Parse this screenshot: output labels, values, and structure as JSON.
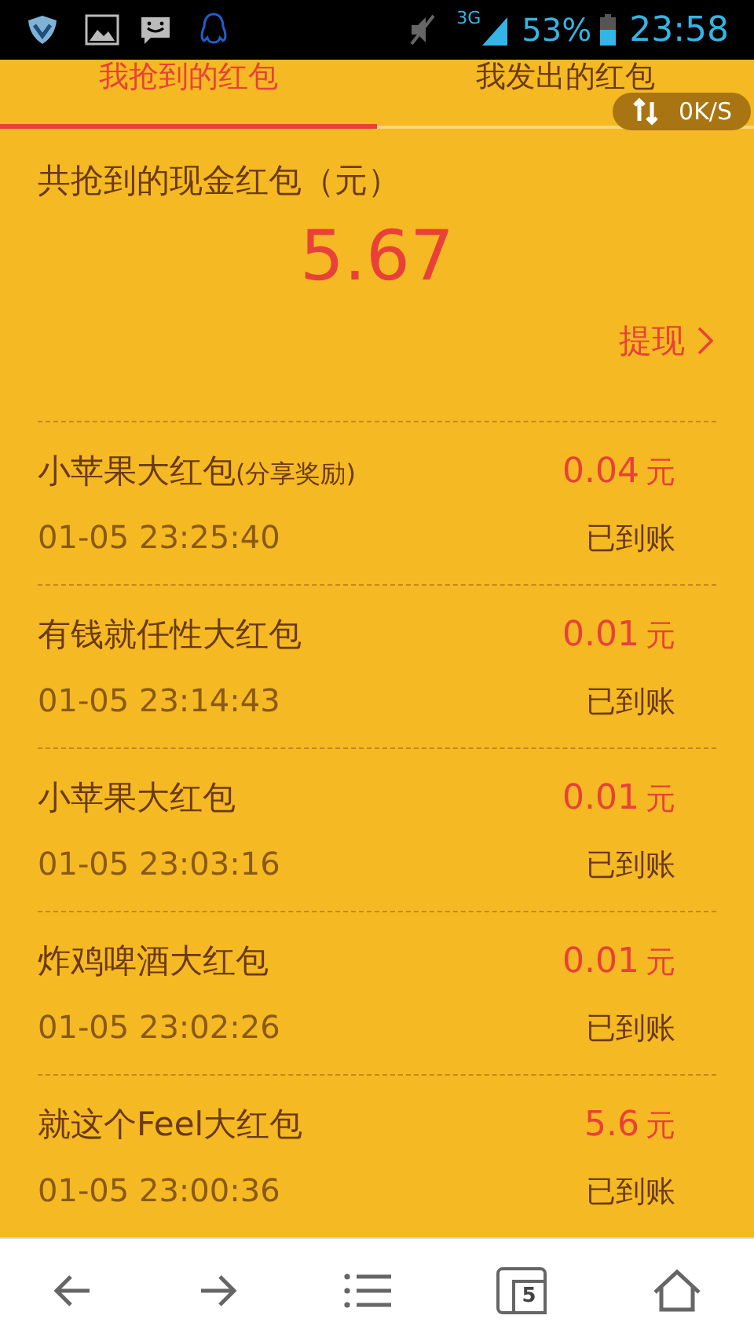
{
  "status_bar": {
    "network": "3G",
    "battery": "53%",
    "time": "23:58"
  },
  "tabs": [
    {
      "label": "我抢到的红包",
      "selected": true
    },
    {
      "label": "我发出的红包",
      "selected": false
    }
  ],
  "speed_badge": "0K/S",
  "summary": {
    "label": "共抢到的现金红包（元）",
    "amount": "5.67",
    "withdraw": "提现"
  },
  "records": [
    {
      "title": "小苹果大红包",
      "note": "(分享奖励)",
      "time": "01-05 23:25:40",
      "amount": "0.04",
      "unit": "元",
      "status": "已到账"
    },
    {
      "title": "有钱就任性大红包",
      "time": "01-05 23:14:43",
      "amount": "0.01",
      "unit": "元",
      "status": "已到账"
    },
    {
      "title": "小苹果大红包",
      "time": "01-05 23:03:16",
      "amount": "0.01",
      "unit": "元",
      "status": "已到账"
    },
    {
      "title": "炸鸡啤酒大红包",
      "time": "01-05 23:02:26",
      "amount": "0.01",
      "unit": "元",
      "status": "已到账"
    },
    {
      "title": "就这个Feel大红包",
      "time": "01-05 23:00:36",
      "amount": "5.6",
      "unit": "元",
      "status": "已到账"
    }
  ],
  "bottom_nav": {
    "tab_count": "5"
  }
}
